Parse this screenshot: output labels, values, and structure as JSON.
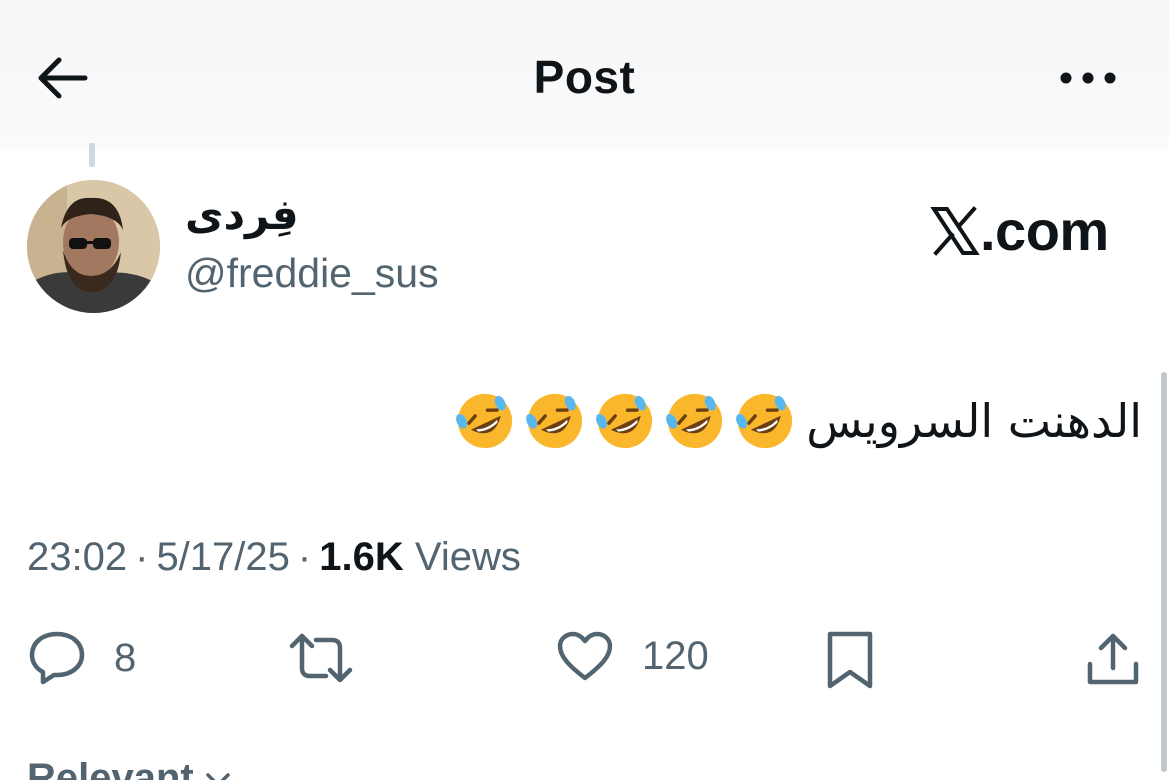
{
  "header": {
    "title": "Post",
    "back_icon": "arrow-left-icon",
    "more_icon": "more-horizontal-icon"
  },
  "author": {
    "display_name": "فِردی",
    "handle": "@freddie_sus",
    "avatar": "avatar-photo"
  },
  "brand": {
    "label": ".com",
    "logo_icon": "x-logo-icon"
  },
  "post": {
    "text": "الدهنت السرويس",
    "emoji_count": 5,
    "emoji": "rolling-on-floor-laughing-emoji"
  },
  "meta": {
    "time": "23:02",
    "date": "5/17/25",
    "views_count": "1.6K",
    "views_label": "Views",
    "separator": "·"
  },
  "actions": {
    "replies": "8",
    "reposts": "",
    "likes": "120",
    "reply_icon": "reply-icon",
    "repost_icon": "repost-icon",
    "like_icon": "heart-icon",
    "bookmark_icon": "bookmark-icon",
    "share_icon": "share-icon"
  },
  "footer": {
    "relevant_label": "Relevant"
  },
  "colors": {
    "text": "#0f1419",
    "secondary": "#536471",
    "emoji_face": "#fbb72b"
  }
}
